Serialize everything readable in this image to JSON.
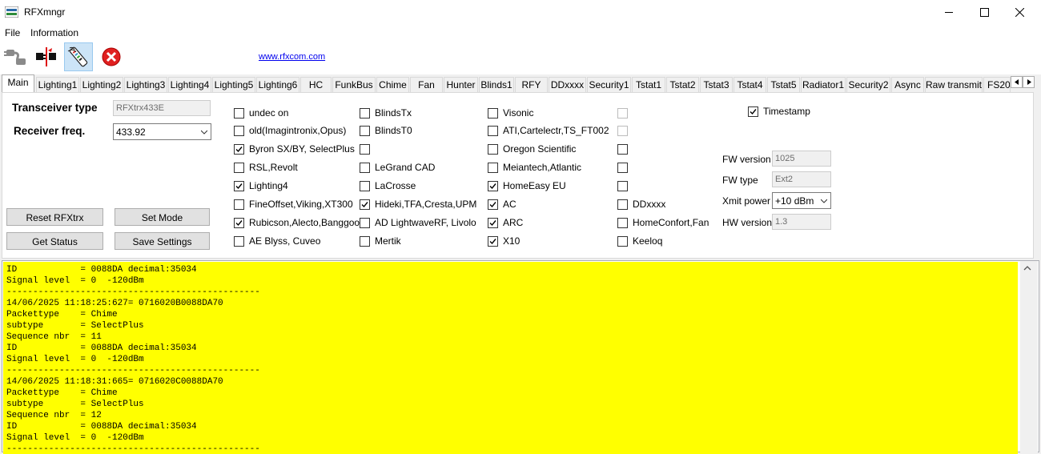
{
  "window": {
    "title": "RFXmngr"
  },
  "menu": {
    "file": "File",
    "information": "Information"
  },
  "toolbar": {
    "link": "www.rfxcom.com"
  },
  "tabs": [
    "Main",
    "Lighting1",
    "Lighting2",
    "Lighting3",
    "Lighting4",
    "Lighting5",
    "Lighting6",
    "HC",
    "FunkBus",
    "Chime",
    "Fan",
    "Hunter",
    "Blinds1",
    "RFY",
    "DDxxxx",
    "Security1",
    "Tstat1",
    "Tstat2",
    "Tstat3",
    "Tstat4",
    "Tstat5",
    "Radiator1",
    "Security2",
    "Async",
    "Raw transmit",
    "FS20"
  ],
  "main": {
    "transceiver_label": "Transceiver type",
    "transceiver_value": "RFXtrx433E",
    "freq_label": "Receiver freq.",
    "freq_value": "433.92",
    "buttons": {
      "reset": "Reset RFXtrx",
      "set_mode": "Set Mode",
      "get_status": "Get Status",
      "save_settings": "Save Settings"
    },
    "col1": [
      {
        "label": "undec on",
        "checked": false
      },
      {
        "label": "old(Imagintronix,Opus)",
        "checked": false
      },
      {
        "label": "Byron SX/BY, SelectPlus",
        "checked": true
      },
      {
        "label": "RSL,Revolt",
        "checked": false
      },
      {
        "label": "Lighting4",
        "checked": true
      },
      {
        "label": "FineOffset,Viking,XT300",
        "checked": false
      },
      {
        "label": "Rubicson,Alecto,Banggood",
        "checked": true
      },
      {
        "label": "AE Blyss, Cuveo",
        "checked": false
      }
    ],
    "col2": [
      {
        "label": "BlindsTx",
        "checked": false
      },
      {
        "label": "BlindsT0",
        "checked": false
      },
      {
        "label": "",
        "checked": false
      },
      {
        "label": "LeGrand CAD",
        "checked": false
      },
      {
        "label": "LaCrosse",
        "checked": false
      },
      {
        "label": "Hideki,TFA,Cresta,UPM",
        "checked": true
      },
      {
        "label": "AD LightwaveRF, Livolo",
        "checked": false
      },
      {
        "label": "Mertik",
        "checked": false
      }
    ],
    "col3": [
      {
        "label": "Visonic",
        "checked": false
      },
      {
        "label": "ATI,Cartelectr,TS_FT002",
        "checked": false
      },
      {
        "label": "Oregon Scientific",
        "checked": false
      },
      {
        "label": "Meiantech,Atlantic",
        "checked": false
      },
      {
        "label": "HomeEasy EU",
        "checked": true
      },
      {
        "label": "AC",
        "checked": true
      },
      {
        "label": "ARC",
        "checked": true
      },
      {
        "label": "X10",
        "checked": true
      }
    ],
    "col4": [
      {
        "label": "",
        "checked": false,
        "disabled": true
      },
      {
        "label": "",
        "checked": false,
        "disabled": true
      },
      {
        "label": "",
        "checked": false
      },
      {
        "label": "",
        "checked": false
      },
      {
        "label": "",
        "checked": false
      },
      {
        "label": "DDxxxx",
        "checked": false
      },
      {
        "label": "HomeConfort,Fan",
        "checked": false
      },
      {
        "label": "Keeloq",
        "checked": false
      }
    ],
    "timestamp": {
      "label": "Timestamp",
      "checked": true
    },
    "fw_version_label": "FW version",
    "fw_version_value": "1025",
    "fw_type_label": "FW type",
    "fw_type_value": "Ext2",
    "xmit_power_label": "Xmit power",
    "xmit_power_value": "+10 dBm",
    "hw_version_label": "HW version",
    "hw_version_value": "1.3"
  },
  "log": {
    "lines": [
      "ID            = 0088DA decimal:35034",
      "Signal level  = 0  -120dBm",
      "------------------------------------------------",
      "14/06/2025 11:18:25:627= 0716020B0088DA70",
      "Packettype    = Chime",
      "subtype       = SelectPlus",
      "Sequence nbr  = 11",
      "ID            = 0088DA decimal:35034",
      "Signal level  = 0  -120dBm",
      "------------------------------------------------",
      "14/06/2025 11:18:31:665= 0716020C0088DA70",
      "Packettype    = Chime",
      "subtype       = SelectPlus",
      "Sequence nbr  = 12",
      "ID            = 0088DA decimal:35034",
      "Signal level  = 0  -120dBm",
      "------------------------------------------------"
    ]
  },
  "colors": {
    "log_background": "#ffff00",
    "link": "#0000ee",
    "selected_tool": "#cce4f7"
  }
}
